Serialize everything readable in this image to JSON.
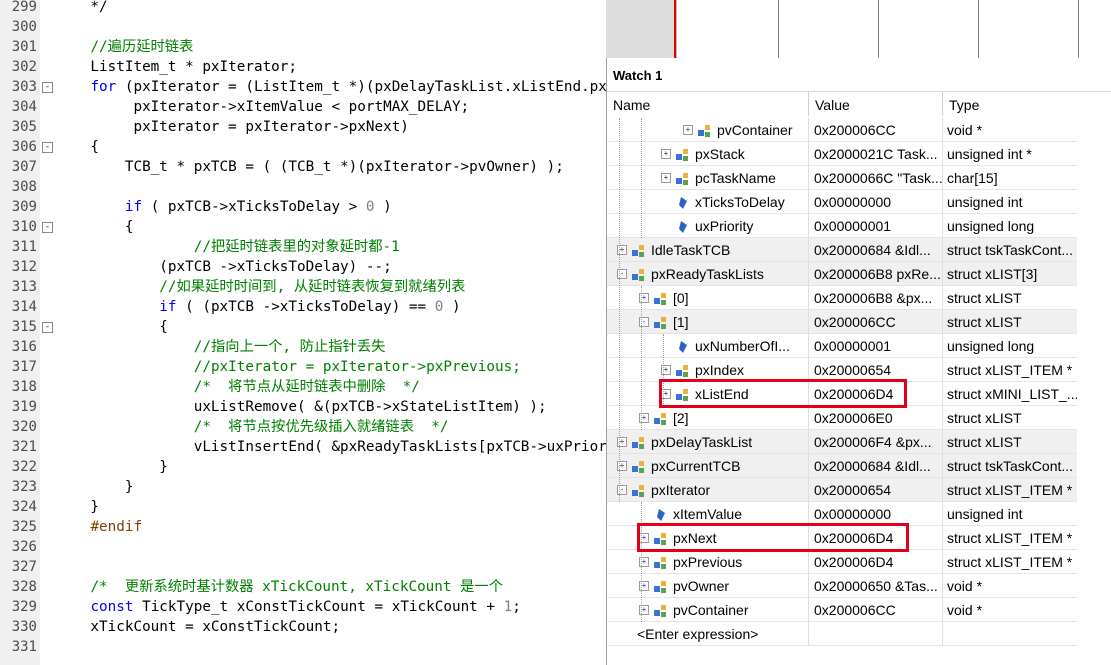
{
  "editor": {
    "lines": [
      {
        "n": "299",
        "fold": "",
        "segs": [
          [
            "",
            "    */"
          ]
        ]
      },
      {
        "n": "300",
        "fold": "",
        "segs": [
          [
            "",
            ""
          ]
        ]
      },
      {
        "n": "301",
        "fold": "",
        "segs": [
          [
            "",
            "    "
          ],
          [
            "cm",
            "//遍历延时链表"
          ]
        ]
      },
      {
        "n": "302",
        "fold": "",
        "segs": [
          [
            "",
            "    ListItem_t * pxIterator;"
          ]
        ]
      },
      {
        "n": "303",
        "fold": "-",
        "segs": [
          [
            "",
            "    "
          ],
          [
            "kw",
            "for"
          ],
          [
            "",
            " (pxIterator = (ListItem_t *)(pxDelayTaskList.xListEnd.pxNext);"
          ]
        ]
      },
      {
        "n": "304",
        "fold": "",
        "segs": [
          [
            "",
            "         pxIterator->xItemValue < portMAX_DELAY;"
          ]
        ]
      },
      {
        "n": "305",
        "fold": "",
        "segs": [
          [
            "",
            "         pxIterator = pxIterator->pxNext)"
          ]
        ]
      },
      {
        "n": "306",
        "fold": "-",
        "segs": [
          [
            "",
            "    {"
          ]
        ]
      },
      {
        "n": "307",
        "fold": "",
        "segs": [
          [
            "",
            "        TCB_t * pxTCB = ( (TCB_t *)(pxIterator->pvOwner) );"
          ]
        ]
      },
      {
        "n": "308",
        "fold": "",
        "segs": [
          [
            "",
            ""
          ]
        ]
      },
      {
        "n": "309",
        "fold": "",
        "segs": [
          [
            "",
            "        "
          ],
          [
            "kw",
            "if"
          ],
          [
            "",
            " ( pxTCB->xTicksToDelay > "
          ],
          [
            "num",
            "0"
          ],
          [
            "",
            " )"
          ]
        ]
      },
      {
        "n": "310",
        "fold": "-",
        "segs": [
          [
            "",
            "        {"
          ]
        ]
      },
      {
        "n": "311",
        "fold": "",
        "segs": [
          [
            "",
            "                "
          ],
          [
            "cm",
            "//把延时链表里的对象延时都-1"
          ]
        ]
      },
      {
        "n": "312",
        "fold": "",
        "segs": [
          [
            "",
            "            (pxTCB ->xTicksToDelay) --;"
          ]
        ]
      },
      {
        "n": "313",
        "fold": "",
        "segs": [
          [
            "",
            "            "
          ],
          [
            "cm",
            "//如果延时时间到, 从延时链表恢复到就绪列表"
          ]
        ]
      },
      {
        "n": "314",
        "fold": "",
        "segs": [
          [
            "",
            "            "
          ],
          [
            "kw",
            "if"
          ],
          [
            "",
            " ( (pxTCB ->xTicksToDelay) == "
          ],
          [
            "num",
            "0"
          ],
          [
            "",
            " )"
          ]
        ]
      },
      {
        "n": "315",
        "fold": "-",
        "segs": [
          [
            "",
            "            {"
          ]
        ]
      },
      {
        "n": "316",
        "fold": "",
        "segs": [
          [
            "",
            "                "
          ],
          [
            "cm",
            "//指向上一个, 防止指针丢失"
          ]
        ]
      },
      {
        "n": "317",
        "fold": "",
        "segs": [
          [
            "",
            "                "
          ],
          [
            "cm",
            "//pxIterator = pxIterator->pxPrevious;"
          ]
        ]
      },
      {
        "n": "318",
        "fold": "",
        "segs": [
          [
            "",
            "                "
          ],
          [
            "cm",
            "/*  将节点从延时链表中删除  */"
          ]
        ]
      },
      {
        "n": "319",
        "fold": "",
        "segs": [
          [
            "",
            "                uxListRemove( &(pxTCB->xStateListItem) );"
          ]
        ]
      },
      {
        "n": "320",
        "fold": "",
        "segs": [
          [
            "",
            "                "
          ],
          [
            "cm",
            "/*  将节点按优先级插入就绪链表  */"
          ]
        ]
      },
      {
        "n": "321",
        "fold": "",
        "segs": [
          [
            "",
            "                vListInsertEnd( &pxReadyTaskLists[pxTCB->uxPriority],"
          ]
        ]
      },
      {
        "n": "322",
        "fold": "",
        "segs": [
          [
            "",
            "            }"
          ]
        ]
      },
      {
        "n": "323",
        "fold": "",
        "segs": [
          [
            "",
            "        }"
          ]
        ]
      },
      {
        "n": "324",
        "fold": "",
        "segs": [
          [
            "",
            "    }"
          ]
        ]
      },
      {
        "n": "325",
        "fold": "",
        "segs": [
          [
            "",
            "    "
          ],
          [
            "pp",
            "#endif"
          ]
        ]
      },
      {
        "n": "326",
        "fold": "",
        "segs": [
          [
            "",
            ""
          ]
        ]
      },
      {
        "n": "327",
        "fold": "",
        "segs": [
          [
            "",
            ""
          ]
        ]
      },
      {
        "n": "328",
        "fold": "",
        "segs": [
          [
            "",
            "    "
          ],
          [
            "cm",
            "/*  更新系统时基计数器 xTickCount, xTickCount 是一个"
          ]
        ]
      },
      {
        "n": "329",
        "fold": "",
        "segs": [
          [
            "",
            "    "
          ],
          [
            "kw",
            "const"
          ],
          [
            "",
            " TickType_t xConstTickCount = xTickCount + "
          ],
          [
            "num",
            "1"
          ],
          [
            "",
            ";"
          ]
        ]
      },
      {
        "n": "330",
        "fold": "",
        "segs": [
          [
            "",
            "    xTickCount = xConstTickCount;"
          ]
        ]
      },
      {
        "n": "331",
        "fold": "",
        "segs": [
          [
            "",
            ""
          ]
        ]
      }
    ]
  },
  "watch": {
    "title": "Watch 1",
    "columns": {
      "name": "Name",
      "value": "Value",
      "type": "Type"
    },
    "rows": [
      {
        "level": 4,
        "exp": "+",
        "icon": "struct-icon",
        "name": "pvContainer",
        "value": "0x200006CC",
        "type": "void *",
        "shade": false
      },
      {
        "level": 3,
        "exp": "+",
        "icon": "struct-icon",
        "name": "pxStack",
        "value": "0x2000021C Task...",
        "type": "unsigned int *",
        "shade": false
      },
      {
        "level": 3,
        "exp": "+",
        "icon": "struct-icon",
        "name": "pcTaskName",
        "value": "0x2000066C \"Task...",
        "type": "char[15]",
        "shade": false
      },
      {
        "level": 3,
        "exp": "",
        "icon": "variable-icon",
        "name": "xTicksToDelay",
        "value": "0x00000000",
        "type": "unsigned int",
        "shade": false
      },
      {
        "level": 3,
        "exp": "",
        "icon": "variable-icon",
        "name": "uxPriority",
        "value": "0x00000001",
        "type": "unsigned long",
        "shade": false
      },
      {
        "level": 1,
        "exp": "+",
        "icon": "struct-icon",
        "name": "IdleTaskTCB",
        "value": "0x20000684 &Idl...",
        "type": "struct tskTaskCont...",
        "shade": true
      },
      {
        "level": 1,
        "exp": "-",
        "icon": "struct-icon",
        "name": "pxReadyTaskLists",
        "value": "0x200006B8 pxRe...",
        "type": "struct xLIST[3]",
        "shade": true
      },
      {
        "level": 2,
        "exp": "+",
        "icon": "struct-icon",
        "name": "[0]",
        "value": "0x200006B8 &px...",
        "type": "struct xLIST",
        "shade": false
      },
      {
        "level": 2,
        "exp": "-",
        "icon": "struct-icon",
        "name": "[1]",
        "value": "0x200006CC",
        "type": "struct xLIST",
        "shade": true
      },
      {
        "level": 3,
        "exp": "",
        "icon": "variable-icon",
        "name": "uxNumberOfI...",
        "value": "0x00000001",
        "type": "unsigned long",
        "shade": false
      },
      {
        "level": 3,
        "exp": "+",
        "icon": "struct-icon",
        "name": "pxIndex",
        "value": "0x20000654",
        "type": "struct xLIST_ITEM *",
        "shade": false
      },
      {
        "level": 3,
        "exp": "+",
        "icon": "struct-icon",
        "name": "xListEnd",
        "value": "0x200006D4",
        "type": "struct xMINI_LIST_...",
        "shade": false
      },
      {
        "level": 2,
        "exp": "+",
        "icon": "struct-icon",
        "name": "[2]",
        "value": "0x200006E0",
        "type": "struct xLIST",
        "shade": false
      },
      {
        "level": 1,
        "exp": "+",
        "icon": "struct-icon",
        "name": "pxDelayTaskList",
        "value": "0x200006F4 &px...",
        "type": "struct xLIST",
        "shade": true
      },
      {
        "level": 1,
        "exp": "+",
        "icon": "struct-icon",
        "name": "pxCurrentTCB",
        "value": "0x20000684 &Idl...",
        "type": "struct tskTaskCont...",
        "shade": true
      },
      {
        "level": 1,
        "exp": "-",
        "icon": "struct-icon",
        "name": "pxIterator",
        "value": "0x20000654",
        "type": "struct xLIST_ITEM *",
        "shade": true
      },
      {
        "level": 2,
        "exp": "",
        "icon": "variable-icon",
        "name": "xItemValue",
        "value": "0x00000000",
        "type": "unsigned int",
        "shade": false
      },
      {
        "level": 2,
        "exp": "+",
        "icon": "struct-icon",
        "name": "pxNext",
        "value": "0x200006D4",
        "type": "struct xLIST_ITEM *",
        "shade": false
      },
      {
        "level": 2,
        "exp": "+",
        "icon": "struct-icon",
        "name": "pxPrevious",
        "value": "0x200006D4",
        "type": "struct xLIST_ITEM *",
        "shade": false
      },
      {
        "level": 2,
        "exp": "+",
        "icon": "struct-icon",
        "name": "pvOwner",
        "value": "0x20000650 &Tas...",
        "type": "void *",
        "shade": false
      },
      {
        "level": 2,
        "exp": "+",
        "icon": "struct-icon",
        "name": "pvContainer",
        "value": "0x200006CC",
        "type": "void *",
        "shade": false
      }
    ],
    "enter_expression": "<Enter expression>",
    "highlight_color": "#e0001a"
  }
}
